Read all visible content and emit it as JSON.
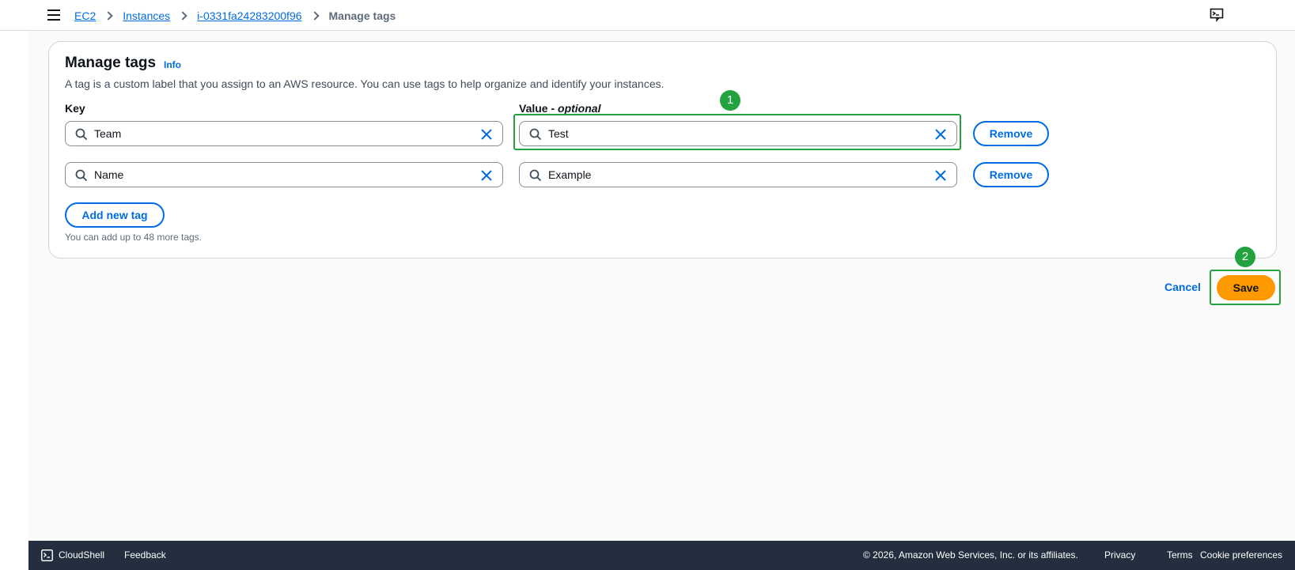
{
  "breadcrumb": {
    "items": [
      "EC2",
      "Instances",
      "i-0331fa24283200f96"
    ],
    "current": "Manage tags"
  },
  "panel": {
    "title": "Manage tags",
    "info_label": "Info",
    "description": "A tag is a custom label that you assign to an AWS resource. You can use tags to help organize and identify your instances.",
    "key_label": "Key",
    "value_label_main": "Value - ",
    "value_label_optional": "optional",
    "tags": [
      {
        "key": "Team",
        "value": "Test",
        "remove_label": "Remove"
      },
      {
        "key": "Name",
        "value": "Example",
        "remove_label": "Remove"
      }
    ],
    "add_tag_label": "Add new tag",
    "hint": "You can add up to 48 more tags."
  },
  "actions": {
    "cancel_label": "Cancel",
    "save_label": "Save"
  },
  "annotations": {
    "badge_1": "1",
    "badge_2": "2",
    "highlight_color": "#22a33f"
  },
  "footer": {
    "cloudshell_label": "CloudShell",
    "feedback_label": "Feedback",
    "copyright": "© 2026, Amazon Web Services, Inc. or its affiliates.",
    "privacy_label": "Privacy",
    "terms_label": "Terms",
    "cookie_label": "Cookie preferences"
  },
  "colors": {
    "link": "#006ce0",
    "save_button": "#ff9900",
    "footer_bg": "#232f3e"
  },
  "icons": [
    "menu-icon",
    "chevron-right-icon",
    "feedback-icon",
    "search-icon",
    "close-icon",
    "cloudshell-icon"
  ]
}
